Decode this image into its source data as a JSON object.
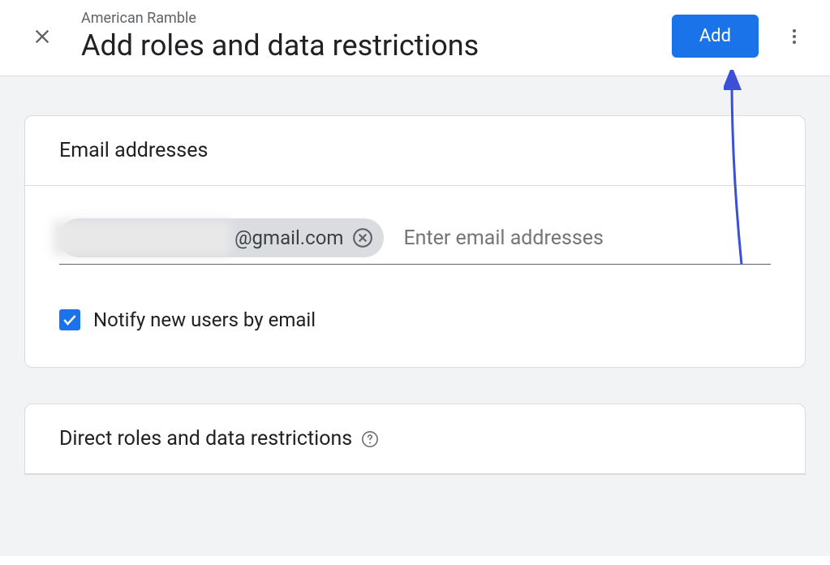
{
  "header": {
    "breadcrumb": "American Ramble",
    "title": "Add roles and data restrictions",
    "add_button_label": "Add"
  },
  "email_section": {
    "header": "Email addresses",
    "chip_domain": "@gmail.com",
    "placeholder": "Enter email addresses",
    "notify_label": "Notify new users by email",
    "notify_checked": true
  },
  "roles_section": {
    "header": "Direct roles and data restrictions"
  }
}
